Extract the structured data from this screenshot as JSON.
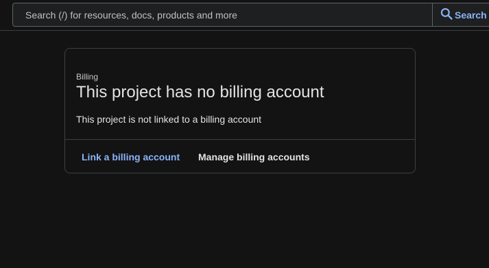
{
  "search": {
    "placeholder": "Search (/) for resources, docs, products and more",
    "button_label": "Search",
    "icon": "search-icon",
    "accent_color": "#8ab4f8"
  },
  "billing_card": {
    "overline": "Billing",
    "title": "This project has no billing account",
    "body": "This project is not linked to a billing account",
    "actions": {
      "link_label": "Link a billing account",
      "manage_label": "Manage billing accounts"
    }
  }
}
